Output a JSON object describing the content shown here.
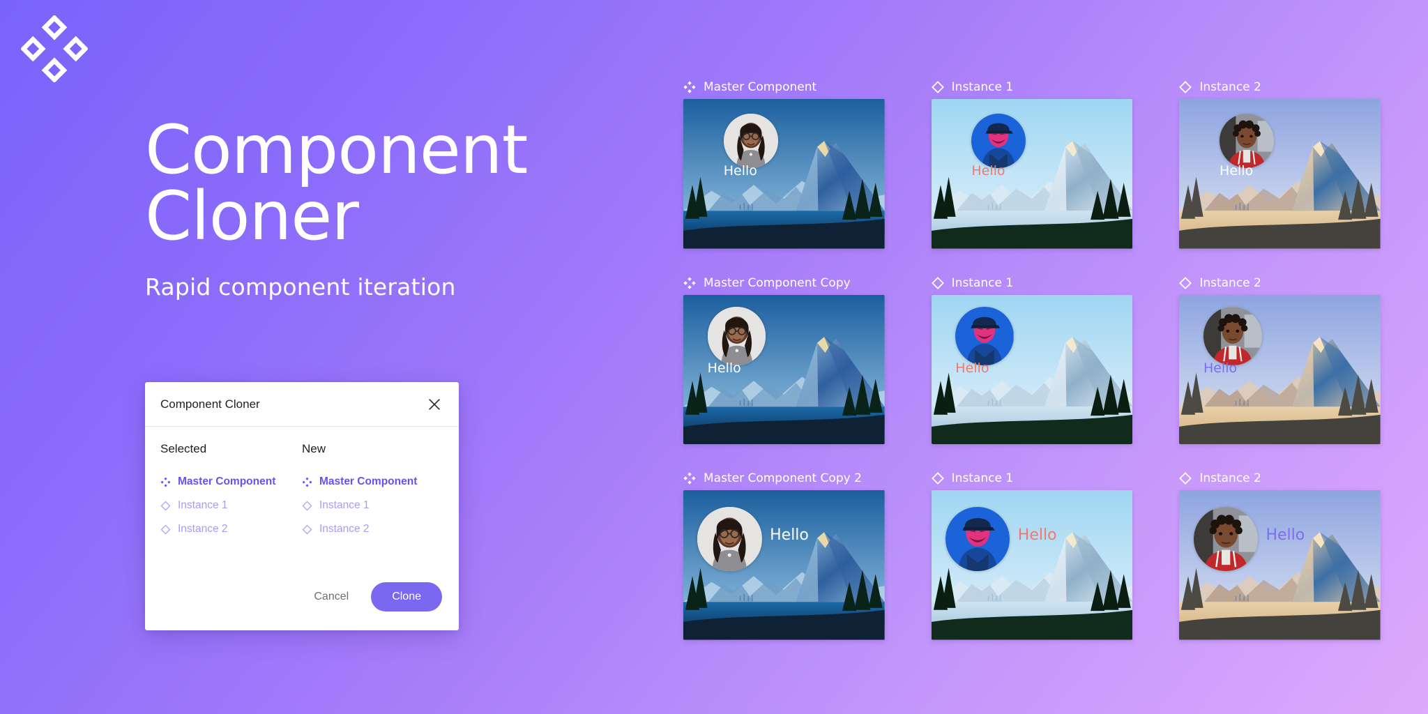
{
  "brand": {
    "logo_icon": "component-diamond-logo"
  },
  "hero": {
    "title": "Component\nCloner",
    "subtitle": "Rapid component iteration"
  },
  "dialog": {
    "title": "Component Cloner",
    "close_icon": "close-icon",
    "columns": [
      {
        "heading": "Selected",
        "items": [
          {
            "label": "Master Component",
            "icon": "master-component-icon",
            "type": "master"
          },
          {
            "label": "Instance 1",
            "icon": "instance-diamond-icon",
            "type": "instance"
          },
          {
            "label": "Instance 2",
            "icon": "instance-diamond-icon",
            "type": "instance"
          }
        ]
      },
      {
        "heading": "New",
        "items": [
          {
            "label": "Master Component",
            "icon": "master-component-icon",
            "type": "master"
          },
          {
            "label": "Instance 1",
            "icon": "instance-diamond-icon",
            "type": "instance"
          },
          {
            "label": "Instance 2",
            "icon": "instance-diamond-icon",
            "type": "instance"
          }
        ]
      }
    ],
    "cancel_label": "Cancel",
    "clone_label": "Clone"
  },
  "colors": {
    "accent": "#7b68f0",
    "master_text": "#6b4ef5",
    "instance_text": "#a99bf0",
    "bg_start": "#7a63fb",
    "bg_end": "#dda9fc"
  },
  "grid": {
    "cards": [
      {
        "label": "Master Component",
        "icon": "master-component-icon",
        "greeting": "Hello",
        "greeting_color": "#ffffff",
        "theme": "blue",
        "layout": "vA"
      },
      {
        "label": "Instance 1",
        "icon": "instance-diamond-icon",
        "greeting": "Hello",
        "greeting_color": "#f4776e",
        "theme": "lightblue",
        "layout": "vA"
      },
      {
        "label": "Instance 2",
        "icon": "instance-diamond-icon",
        "greeting": "Hello",
        "greeting_color": "#ffffff",
        "theme": "sand",
        "layout": "vA"
      },
      {
        "label": "Master Component Copy",
        "icon": "master-component-icon",
        "greeting": "Hello",
        "greeting_color": "#ffffff",
        "theme": "blue",
        "layout": "vB"
      },
      {
        "label": "Instance 1",
        "icon": "instance-diamond-icon",
        "greeting": "Hello",
        "greeting_color": "#f4776e",
        "theme": "lightblue",
        "layout": "vB"
      },
      {
        "label": "Instance 2",
        "icon": "instance-diamond-icon",
        "greeting": "Hello",
        "greeting_color": "#7b6ef0",
        "theme": "sand",
        "layout": "vB"
      },
      {
        "label": "Master Component Copy 2",
        "icon": "master-component-icon",
        "greeting": "Hello",
        "greeting_color": "#ffffff",
        "theme": "blue",
        "layout": "vC"
      },
      {
        "label": "Instance 1",
        "icon": "instance-diamond-icon",
        "greeting": "Hello",
        "greeting_color": "#f4776e",
        "theme": "lightblue",
        "layout": "vC"
      },
      {
        "label": "Instance 2",
        "icon": "instance-diamond-icon",
        "greeting": "Hello",
        "greeting_color": "#7b6ef0",
        "theme": "sand",
        "layout": "vC"
      }
    ]
  }
}
